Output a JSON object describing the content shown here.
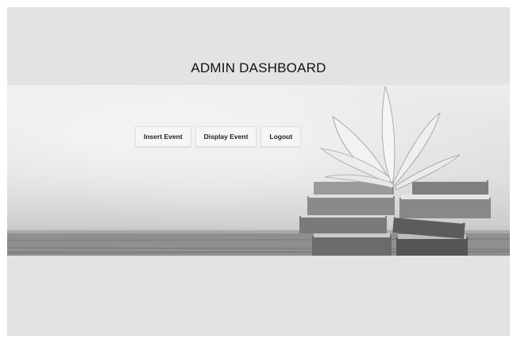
{
  "header": {
    "title": "ADMIN DASHBOARD"
  },
  "nav": {
    "items": [
      {
        "label": "Insert Event"
      },
      {
        "label": "Display Event"
      },
      {
        "label": "Logout"
      }
    ]
  },
  "hero": {
    "image": "books-stack-on-wooden-table-image"
  }
}
